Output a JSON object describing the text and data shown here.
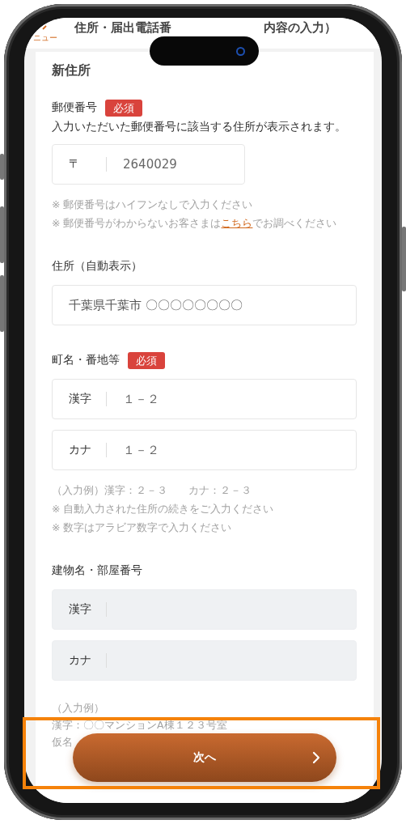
{
  "header": {
    "back_label": "ニュー",
    "title_before_camera": "住所・届出電話番",
    "title_after_camera": "内容の入力）"
  },
  "section_title": "新住所",
  "groups": [
    {
      "label": "郵便番号",
      "badge": "必須",
      "description": "入力いただいた郵便番号に該当する住所が表示されます。",
      "inputs": [
        {
          "kind": "short",
          "prefix": "〒",
          "value": "2640029",
          "filled": true
        }
      ],
      "notes": [
        {
          "text": "※ 郵便番号はハイフンなしで入力ください"
        },
        {
          "text": "※ 郵便番号がわからないお客さまは",
          "link": "こちら",
          "after": "でお調べください"
        }
      ]
    },
    {
      "label": "住所（自動表示）",
      "inputs": [
        {
          "kind": "wide",
          "value": "千葉県千葉市 〇〇〇〇〇〇〇〇",
          "filled": true
        }
      ]
    },
    {
      "label": "町名・番地等",
      "badge": "必須",
      "inputs": [
        {
          "kind": "wide",
          "prefix": "漢字",
          "value": "１－２",
          "filled": true
        },
        {
          "kind": "wide",
          "prefix": "カナ",
          "value": "１－２",
          "filled": true
        }
      ],
      "notes": [
        {
          "text": "（入力例）漢字：２－３　　カナ：２－３"
        },
        {
          "text": "※ 自動入力された住所の続きをご入力ください"
        },
        {
          "text": "※ 数字はアラビア数字で入力ください"
        }
      ]
    },
    {
      "label": "建物名・部屋番号",
      "inputs": [
        {
          "kind": "wide",
          "prefix": "漢字",
          "filled": false
        },
        {
          "kind": "wide",
          "prefix": "カナ",
          "filled": false
        }
      ],
      "notes": [
        {
          "text": "（入力例）"
        },
        {
          "text": "漢字：〇〇マンションA棟１２３号室"
        },
        {
          "text": "仮名"
        }
      ]
    }
  ],
  "next_button": {
    "label": "次へ",
    "highlighted": true
  }
}
